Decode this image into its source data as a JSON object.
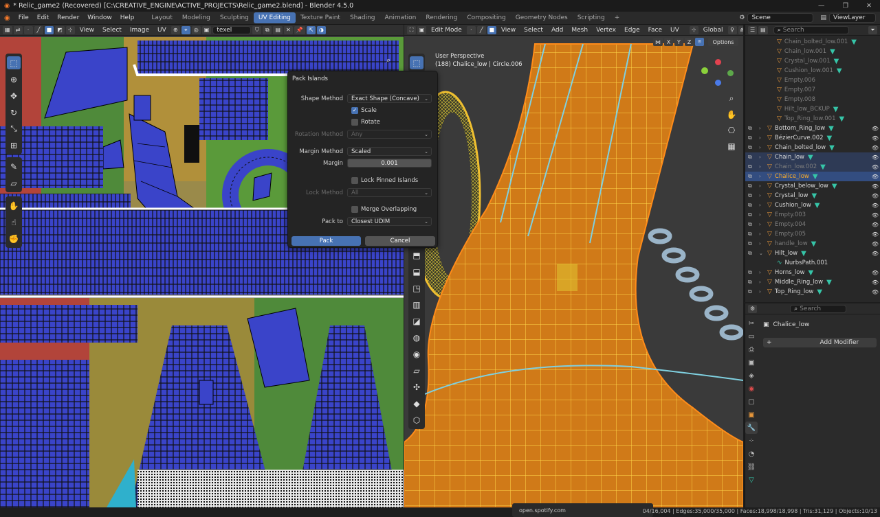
{
  "window": {
    "title": "* Relic_game2 (Recovered) [C:\\CREATIVE_ENGINE\\ACTIVE_PROJECTS\\Relic_game2.blend] - Blender 4.5.0"
  },
  "topbar": {
    "menus": [
      "File",
      "Edit",
      "Render",
      "Window",
      "Help"
    ],
    "workspaces": [
      "Layout",
      "Modeling",
      "Sculpting",
      "UV Editing",
      "Texture Paint",
      "Shading",
      "Animation",
      "Rendering",
      "Compositing",
      "Geometry Nodes",
      "Scripting"
    ],
    "active_workspace": "UV Editing",
    "add_tab": "+",
    "scene": "Scene",
    "view_layer": "ViewLayer"
  },
  "uv_editor": {
    "menus": [
      "View",
      "Select",
      "Image",
      "UV"
    ],
    "image_name": "texel"
  },
  "viewport": {
    "mode": "Edit Mode",
    "menus": [
      "View",
      "Select",
      "Add",
      "Mesh",
      "Vertex",
      "Edge",
      "Face",
      "UV"
    ],
    "transform_orientation": "Global",
    "axes": [
      "X",
      "Y",
      "Z"
    ],
    "options_label": "Options",
    "overlay_title": "User Perspective",
    "overlay_subtitle": "(188) Chalice_low | Circle.006"
  },
  "dialog": {
    "title": "Pack Islands",
    "shape_method_label": "Shape Method",
    "shape_method_value": "Exact Shape (Concave)",
    "scale_label": "Scale",
    "rotate_label": "Rotate",
    "rotation_method_label": "Rotation Method",
    "rotation_method_value": "Any",
    "margin_method_label": "Margin Method",
    "margin_method_value": "Scaled",
    "margin_label": "Margin",
    "margin_value": "0.001",
    "lock_pinned_label": "Lock Pinned Islands",
    "lock_method_label": "Lock Method",
    "lock_method_value": "All",
    "merge_overlapping_label": "Merge Overlapping",
    "pack_to_label": "Pack to",
    "pack_to_value": "Closest UDIM",
    "pack_button": "Pack",
    "cancel_button": "Cancel"
  },
  "outliner": {
    "search_placeholder": "Search",
    "items": [
      {
        "name": "Chain_bolted_low.001",
        "dim": true
      },
      {
        "name": "Chain_low.001",
        "dim": true
      },
      {
        "name": "Crystal_low.001",
        "dim": true
      },
      {
        "name": "Cushion_low.001",
        "dim": true
      },
      {
        "name": "Empty.006",
        "dim": true
      },
      {
        "name": "Empty.007",
        "dim": true
      },
      {
        "name": "Empty.008",
        "dim": true
      },
      {
        "name": "Hilt_low_BCKUP",
        "dim": true
      },
      {
        "name": "Top_Ring_low.001",
        "dim": true
      },
      {
        "name": "Bottom_Ring_low",
        "dim": false
      },
      {
        "name": "BézierCurve.002",
        "dim": false
      },
      {
        "name": "Chain_bolted_low",
        "dim": false
      },
      {
        "name": "Chain_low",
        "dim": false
      },
      {
        "name": "Chain_low.002",
        "dim": true
      },
      {
        "name": "Chalice_low",
        "dim": false
      },
      {
        "name": "Crystal_below_low",
        "dim": false
      },
      {
        "name": "Crystal_low",
        "dim": false
      },
      {
        "name": "Cushion_low",
        "dim": false
      },
      {
        "name": "Empty.003",
        "dim": true
      },
      {
        "name": "Empty.004",
        "dim": true
      },
      {
        "name": "Empty.005",
        "dim": true
      },
      {
        "name": "handle_low",
        "dim": true
      },
      {
        "name": "Hilt_low",
        "dim": false
      },
      {
        "name": "NurbsPath.001",
        "dim": false
      },
      {
        "name": "Horns_low",
        "dim": false
      },
      {
        "name": "Middle_Ring_low",
        "dim": false
      },
      {
        "name": "Top_Ring_low",
        "dim": false
      }
    ]
  },
  "properties": {
    "search_placeholder": "Search",
    "object_name": "Chalice_low",
    "add_modifier": "Add Modifier"
  },
  "statusbar": {
    "url": "open.spotify.com",
    "stats": "04/16,004 | Edges:35,000/35,000 | Faces:18,998/18,998 | Tris:31,129 | Objects:10/13"
  },
  "colors": {
    "accent": "#4772b3",
    "orange_active": "#ffaf29",
    "uv_island_blue": "#3a44c9"
  }
}
